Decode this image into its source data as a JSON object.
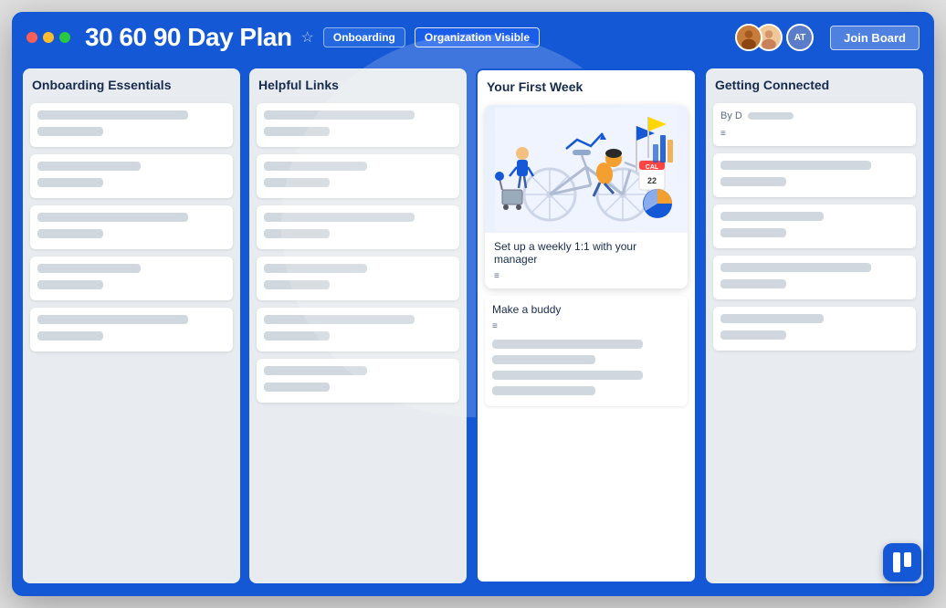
{
  "window": {
    "title": "30 60 90 Day Plan",
    "tags": {
      "onboarding": "Onboarding",
      "org_visible": "Organization Visible"
    },
    "join_board": "Join Board"
  },
  "columns": [
    {
      "id": "col1",
      "title": "Onboarding Essentials",
      "highlighted": false,
      "cards": [
        {
          "type": "placeholder",
          "lines": [
            "long",
            "short"
          ]
        },
        {
          "type": "placeholder",
          "lines": [
            "medium",
            "short"
          ]
        },
        {
          "type": "placeholder",
          "lines": [
            "long",
            "short"
          ]
        },
        {
          "type": "placeholder",
          "lines": [
            "medium",
            "short"
          ]
        },
        {
          "type": "placeholder",
          "lines": [
            "long",
            "short"
          ]
        }
      ]
    },
    {
      "id": "col2",
      "title": "Helpful Links",
      "highlighted": false,
      "cards": [
        {
          "type": "placeholder",
          "lines": [
            "long",
            "short"
          ]
        },
        {
          "type": "placeholder",
          "lines": [
            "medium",
            "short"
          ]
        },
        {
          "type": "placeholder",
          "lines": [
            "long",
            "short"
          ]
        },
        {
          "type": "placeholder",
          "lines": [
            "medium",
            "short"
          ]
        },
        {
          "type": "placeholder",
          "lines": [
            "long",
            "short"
          ]
        },
        {
          "type": "placeholder",
          "lines": [
            "medium",
            "short"
          ]
        }
      ]
    },
    {
      "id": "col3",
      "title": "Your First Week",
      "highlighted": true,
      "cards": [
        {
          "type": "featured",
          "has_image": true,
          "body_text": "Set up a weekly 1:1 with your manager",
          "has_lines": true
        },
        {
          "type": "buddy",
          "title": "Make a buddy",
          "lines": [
            "long",
            "short",
            "long",
            "medium"
          ]
        }
      ]
    },
    {
      "id": "col4",
      "title": "Getting Connected",
      "highlighted": false,
      "cards": [
        {
          "type": "partial",
          "by_label": "By D"
        },
        {
          "type": "placeholder",
          "lines": [
            "long",
            "short"
          ]
        },
        {
          "type": "placeholder",
          "lines": [
            "medium",
            "short"
          ]
        },
        {
          "type": "placeholder",
          "lines": [
            "long",
            "short"
          ]
        },
        {
          "type": "placeholder",
          "lines": [
            "medium",
            "short"
          ]
        }
      ]
    }
  ],
  "avatars": [
    {
      "type": "photo",
      "initials": "",
      "bg": "#c97c3a"
    },
    {
      "type": "photo",
      "initials": "",
      "bg": "#d4a57a"
    },
    {
      "type": "initials",
      "initials": "AT",
      "bg": "#5a7cc9"
    }
  ],
  "trello": {
    "logo_aria": "Trello Logo"
  }
}
